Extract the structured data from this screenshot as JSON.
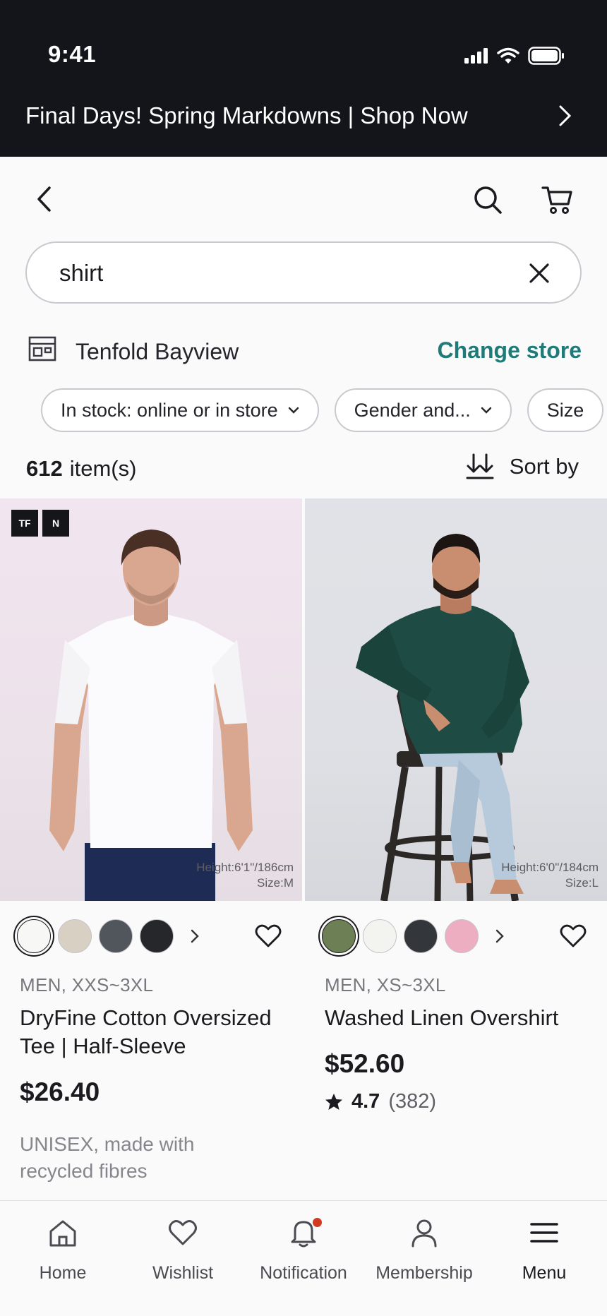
{
  "status_bar": {
    "time": "9:41"
  },
  "promo": {
    "text": "Final Days! Spring Markdowns | Shop Now"
  },
  "search": {
    "value": "shirt"
  },
  "store": {
    "name": "Tenfold Bayview",
    "change_label": "Change store"
  },
  "filters": [
    {
      "label": "In stock: online or in store"
    },
    {
      "label": "Gender and..."
    },
    {
      "label": "Size"
    }
  ],
  "results": {
    "count": "612",
    "count_suffix": "item(s)",
    "sort_label": "Sort by"
  },
  "products": [
    {
      "badges": [
        "TF",
        "N"
      ],
      "model_height": "Height:6'1\"/186cm",
      "model_size": "Size:M",
      "swatches": [
        "#f7f7f5",
        "#d8d0c2",
        "#50565c",
        "#25272b"
      ],
      "meta": "MEN, XXS~3XL",
      "name": "DryFine Cotton Oversized Tee | Half-Sleeve",
      "price": "$26.40",
      "description": "UNISEX, made with recycled fibres"
    },
    {
      "model_height": "Height:6'0\"/184cm",
      "model_size": "Size:L",
      "swatches": [
        "#6d7f55",
        "#f3f3f0",
        "#33363b",
        "#eeaec1"
      ],
      "meta": "MEN, XS~3XL",
      "name": "Washed Linen Overshirt",
      "price": "$52.60",
      "rating": "4.7",
      "reviews": "(382)"
    }
  ],
  "nav": {
    "home": "Home",
    "wishlist": "Wishlist",
    "notification": "Notification",
    "membership": "Membership",
    "menu": "Menu"
  }
}
